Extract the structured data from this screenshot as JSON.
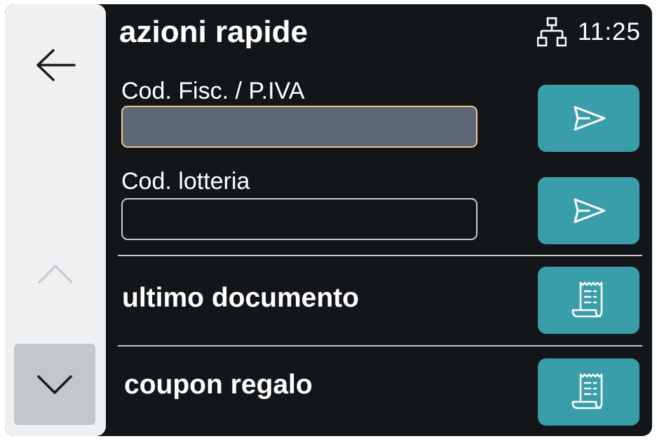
{
  "header": {
    "title": "azioni rapide",
    "time": "11:25"
  },
  "fiscal_code": {
    "label": "Cod. Fisc. / P.IVA",
    "value": ""
  },
  "lottery_code": {
    "label": "Cod. lotteria",
    "value": ""
  },
  "actions": {
    "last_document": "ultimo documento",
    "gift_coupon": "coupon regalo"
  },
  "icons": {
    "back": "arrow-left-icon",
    "scroll_up": "chevron-up-icon",
    "scroll_down": "chevron-down-icon",
    "network": "network-icon",
    "send": "send-icon",
    "receipt": "receipt-icon"
  },
  "colors": {
    "background": "#131619",
    "sidebar": "#eef0f2",
    "accent": "#3a9eaa",
    "focus_border": "#f2c98b",
    "input_fill_focused": "#5b6777"
  }
}
